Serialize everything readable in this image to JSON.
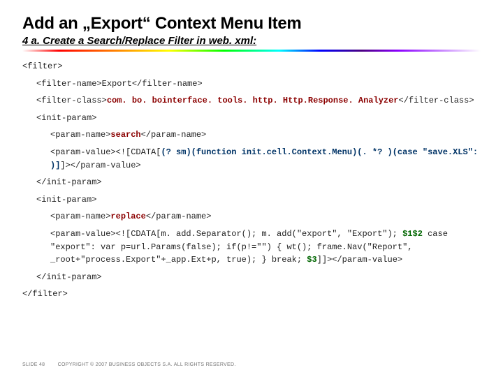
{
  "header": {
    "title": "Add an „Export“ Context Menu Item",
    "subtitle": "4 a. Create a Search/Replace Filter in web. xml:"
  },
  "code": {
    "l01": "<filter>",
    "l02": "<filter-name>Export</filter-name>",
    "l03a": "<filter-class>",
    "l03b": "com. bo. bointerface. tools. http. Http.Response. Analyzer",
    "l03c": "</filter-class>",
    "l04": "<init-param>",
    "l05a": "<param-name>",
    "l05b": "search",
    "l05c": "</param-name>",
    "l06a": "<param-value><![CDATA[",
    "l06b": "(? sm)(function init.cell.Context.Menu)(. *? )(case \"save.XLS\": )]",
    "l06c": "]></param-value>",
    "l07": "</init-param>",
    "l08": "<init-param>",
    "l09a": "<param-name>",
    "l09b": "replace",
    "l09c": "</param-name>",
    "l10a": "<param-value><![CDATA[m. add.Separator(); m. add(\"export\", \"Export\"); ",
    "l10b": "$1",
    "l10b2": "$2",
    "l10c": " case \"export\": var p=url.Params(false); if(p!=\"\") { wt(); frame.Nav(\"Report\", _root+\"process.Export\"+_app.Ext+p, true); } break; ",
    "l10d": "$3",
    "l10e": "]]></param-value>",
    "l11": "</init-param>",
    "l12": "</filter>"
  },
  "footer": {
    "slide_label": "SLIDE 48",
    "copyright": "COPYRIGHT © 2007 BUSINESS OBJECTS S.A. ALL RIGHTS RESERVED."
  }
}
